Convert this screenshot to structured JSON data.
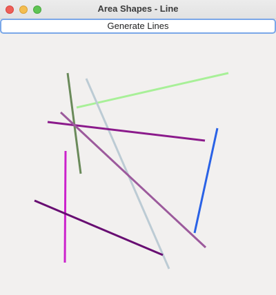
{
  "window": {
    "title": "Area Shapes - Line"
  },
  "toolbar": {
    "generate_label": "Generate Lines"
  },
  "canvas": {
    "background": "#f2f0ef",
    "lines": [
      {
        "color": "#a8f098"
      },
      {
        "color": "#6a8a5a"
      },
      {
        "color": "#bccbd4"
      },
      {
        "color": "#8b1a8b"
      },
      {
        "color": "#9c5a9c"
      },
      {
        "color": "#2a62e6"
      },
      {
        "color": "#cc22cc"
      },
      {
        "color": "#680e72"
      }
    ]
  }
}
